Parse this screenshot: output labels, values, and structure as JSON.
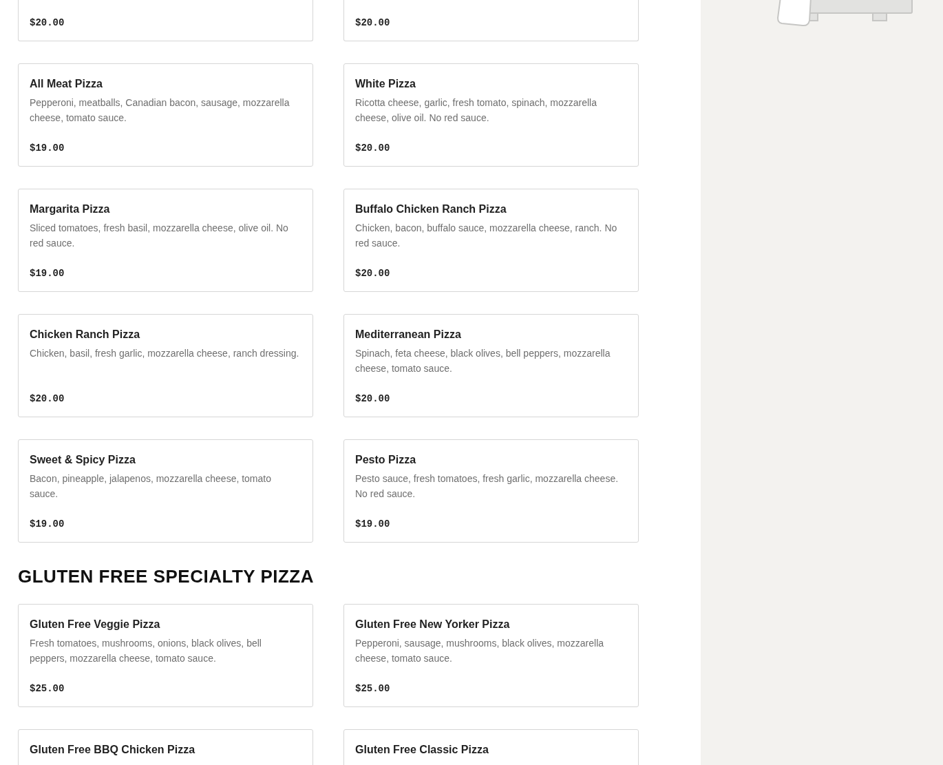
{
  "sections": [
    {
      "items": [
        {
          "price": "$20.00"
        },
        {
          "price": "$20.00"
        },
        {
          "name": "All Meat Pizza",
          "description": "Pepperoni, meatballs, Canadian bacon, sausage, mozzarella cheese, tomato sauce.",
          "price": "$19.00"
        },
        {
          "name": "White Pizza",
          "description": "Ricotta cheese, garlic, fresh tomato, spinach, mozzarella cheese, olive oil. No red sauce.",
          "price": "$20.00"
        },
        {
          "name": "Margarita Pizza",
          "description": "Sliced tomatoes, fresh basil, mozzarella cheese, olive oil. No red sauce.",
          "price": "$19.00"
        },
        {
          "name": "Buffalo Chicken Ranch Pizza",
          "description": "Chicken, bacon, buffalo sauce, mozzarella cheese, ranch. No red sauce.",
          "price": "$20.00"
        },
        {
          "name": "Chicken Ranch Pizza",
          "description": "Chicken, basil, fresh garlic, mozzarella cheese, ranch dressing.",
          "price": "$20.00"
        },
        {
          "name": "Mediterranean Pizza",
          "description": "Spinach, feta cheese, black olives, bell peppers, mozzarella cheese, tomato sauce.",
          "price": "$20.00"
        },
        {
          "name": "Sweet & Spicy Pizza",
          "description": "Bacon, pineapple, jalapenos, mozzarella cheese, tomato sauce.",
          "price": "$19.00"
        },
        {
          "name": "Pesto Pizza",
          "description": "Pesto sauce, fresh tomatoes, fresh garlic, mozzarella cheese. No red sauce.",
          "price": "$19.00"
        }
      ]
    },
    {
      "heading": "GLUTEN FREE SPECIALTY PIZZA",
      "items": [
        {
          "name": "Gluten Free Veggie Pizza",
          "description": "Fresh tomatoes, mushrooms, onions, black olives, bell peppers, mozzarella cheese, tomato sauce.",
          "price": "$25.00"
        },
        {
          "name": "Gluten Free New Yorker Pizza",
          "description": "Pepperoni, sausage, mushrooms, black olives, mozzarella cheese, tomato sauce.",
          "price": "$25.00"
        },
        {
          "name": "Gluten Free BBQ Chicken Pizza"
        },
        {
          "name": "Gluten Free Classic Pizza"
        }
      ]
    }
  ]
}
